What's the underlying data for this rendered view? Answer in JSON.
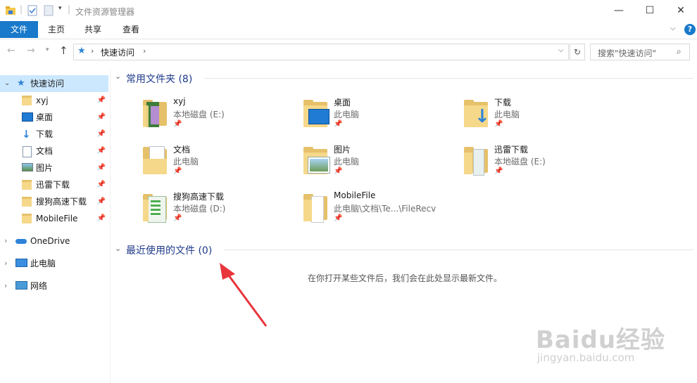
{
  "window": {
    "title": "文件资源管理器",
    "controls": {
      "minimize": "—",
      "maximize": "☐",
      "close": "✕"
    }
  },
  "ribbon": {
    "tabs": [
      "文件",
      "主页",
      "共享",
      "查看"
    ],
    "help": "?"
  },
  "nav": {
    "breadcrumb": "快速访问",
    "search_placeholder": "搜索\"快速访问\""
  },
  "sidebar": {
    "quick_access": "快速访问",
    "items": [
      {
        "label": "xyj",
        "icon": "folder-icon"
      },
      {
        "label": "桌面",
        "icon": "desktop-icon"
      },
      {
        "label": "下载",
        "icon": "download-icon"
      },
      {
        "label": "文档",
        "icon": "document-icon"
      },
      {
        "label": "图片",
        "icon": "picture-icon"
      },
      {
        "label": "迅雷下载",
        "icon": "folder-icon"
      },
      {
        "label": "搜狗高速下载",
        "icon": "folder-icon"
      },
      {
        "label": "MobileFile",
        "icon": "folder-icon"
      }
    ],
    "onedrive": "OneDrive",
    "this_pc": "此电脑",
    "network": "网络"
  },
  "frequent": {
    "title": "常用文件夹 (8)",
    "folders": [
      {
        "name": "xyj",
        "location": "本地磁盘 (E:)"
      },
      {
        "name": "桌面",
        "location": "此电脑"
      },
      {
        "name": "下载",
        "location": "此电脑"
      },
      {
        "name": "文档",
        "location": "此电脑"
      },
      {
        "name": "图片",
        "location": "此电脑"
      },
      {
        "name": "迅雷下载",
        "location": "本地磁盘 (E:)"
      },
      {
        "name": "搜狗高速下载",
        "location": "本地磁盘 (D:)"
      },
      {
        "name": "MobileFile",
        "location": "此电脑\\文档\\Te...\\FileRecv"
      }
    ]
  },
  "recent": {
    "title": "最近使用的文件 (0)",
    "empty_message": "在你打开某些文件后，我们会在此处显示最新文件。"
  },
  "watermark": {
    "brand": "Baidu经验",
    "url": "jingyan.baidu.com"
  },
  "colors": {
    "accent": "#1979ca",
    "annotation_arrow": "#e8353b",
    "section_title": "#1e3a8a"
  }
}
